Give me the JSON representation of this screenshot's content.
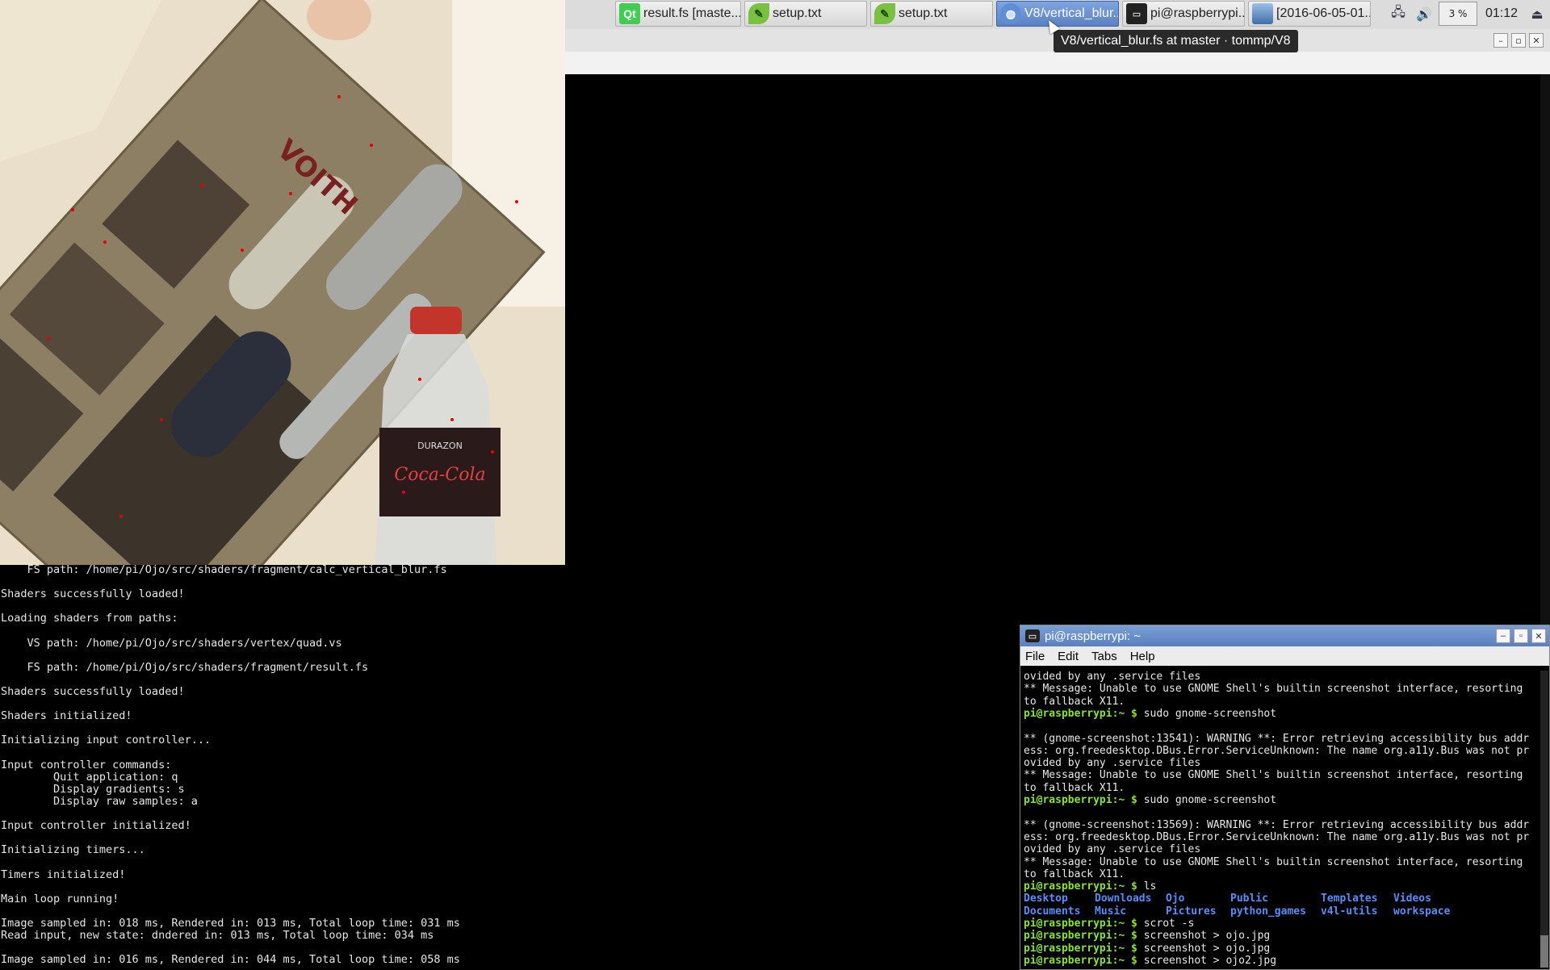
{
  "taskbar": {
    "tasks": [
      {
        "label": "result.fs [maste...",
        "icon": "qt-icon",
        "active": false
      },
      {
        "label": "setup.txt",
        "icon": "leafpad-icon",
        "active": false
      },
      {
        "label": "setup.txt",
        "icon": "leafpad-icon",
        "active": false
      },
      {
        "label": "V8/vertical_blur...",
        "icon": "browser-icon",
        "active": true
      },
      {
        "label": "pi@raspberrypi...",
        "icon": "terminal-icon",
        "active": false
      },
      {
        "label": "[2016-06-05-01...",
        "icon": "image-viewer-icon",
        "active": false
      }
    ],
    "cpu": "3 %",
    "clock": "01:12",
    "qt_glyph": "Qt"
  },
  "tooltip": "V8/vertical_blur.fs at master · tommp/V8",
  "camera": {
    "bottle_label": "Coca-Cola",
    "board_label": "VOITH",
    "brand_label": "DURAZON"
  },
  "console": {
    "lines": [
      "    FS path: /home/pi/Ojo/src/shaders/fragment/calc_vertical_blur.fs",
      "",
      "Shaders successfully loaded!",
      "",
      "Loading shaders from paths:",
      "",
      "    VS path: /home/pi/Ojo/src/shaders/vertex/quad.vs",
      "",
      "    FS path: /home/pi/Ojo/src/shaders/fragment/result.fs",
      "",
      "Shaders successfully loaded!",
      "",
      "Shaders initialized!",
      "",
      "Initializing input controller...",
      "",
      "Input controller commands:",
      "        Quit application: q",
      "        Display gradients: s",
      "        Display raw samples: a",
      "",
      "Input controller initialized!",
      "",
      "Initializing timers...",
      "",
      "Timers initialized!",
      "",
      "Main loop running!",
      "",
      "Image sampled in: 018 ms, Rendered in: 013 ms, Total loop time: 031 ms",
      "Read input, new state: dndered in: 013 ms, Total loop time: 034 ms",
      "",
      "Image sampled in: 016 ms, Rendered in: 044 ms, Total loop time: 058 ms"
    ]
  },
  "terminal": {
    "title": "pi@raspberrypi: ~",
    "menu": [
      "File",
      "Edit",
      "Tabs",
      "Help"
    ],
    "prompt": "pi@raspberrypi:~ $",
    "lines": [
      {
        "t": "text",
        "s": "ovided by any .service files"
      },
      {
        "t": "text",
        "s": "** Message: Unable to use GNOME Shell's builtin screenshot interface, resorting"
      },
      {
        "t": "text",
        "s": "to fallback X11."
      },
      {
        "t": "cmd",
        "s": "sudo gnome-screenshot"
      },
      {
        "t": "text",
        "s": ""
      },
      {
        "t": "text",
        "s": "** (gnome-screenshot:13541): WARNING **: Error retrieving accessibility bus addr"
      },
      {
        "t": "text",
        "s": "ess: org.freedesktop.DBus.Error.ServiceUnknown: The name org.a11y.Bus was not pr"
      },
      {
        "t": "text",
        "s": "ovided by any .service files"
      },
      {
        "t": "text",
        "s": "** Message: Unable to use GNOME Shell's builtin screenshot interface, resorting"
      },
      {
        "t": "text",
        "s": "to fallback X11."
      },
      {
        "t": "cmd",
        "s": "sudo gnome-screenshot"
      },
      {
        "t": "text",
        "s": ""
      },
      {
        "t": "text",
        "s": "** (gnome-screenshot:13569): WARNING **: Error retrieving accessibility bus addr"
      },
      {
        "t": "text",
        "s": "ess: org.freedesktop.DBus.Error.ServiceUnknown: The name org.a11y.Bus was not pr"
      },
      {
        "t": "text",
        "s": "ovided by any .service files"
      },
      {
        "t": "text",
        "s": "** Message: Unable to use GNOME Shell's builtin screenshot interface, resorting"
      },
      {
        "t": "text",
        "s": "to fallback X11."
      },
      {
        "t": "cmd",
        "s": "ls"
      },
      {
        "t": "dirs",
        "items": [
          "Desktop",
          "Downloads",
          "Ojo",
          "Public",
          "Templates",
          "Videos"
        ]
      },
      {
        "t": "dirs",
        "items": [
          "Documents",
          "Music",
          "Pictures",
          "python_games",
          "v4l-utils",
          "workspace"
        ]
      },
      {
        "t": "cmd",
        "s": "scrot -s"
      },
      {
        "t": "cmd",
        "s": "screenshot > ojo.jpg"
      },
      {
        "t": "cmd",
        "s": "screenshot > ojo.jpg"
      },
      {
        "t": "cmd",
        "s": "screenshot > ojo2.jpg"
      }
    ]
  }
}
